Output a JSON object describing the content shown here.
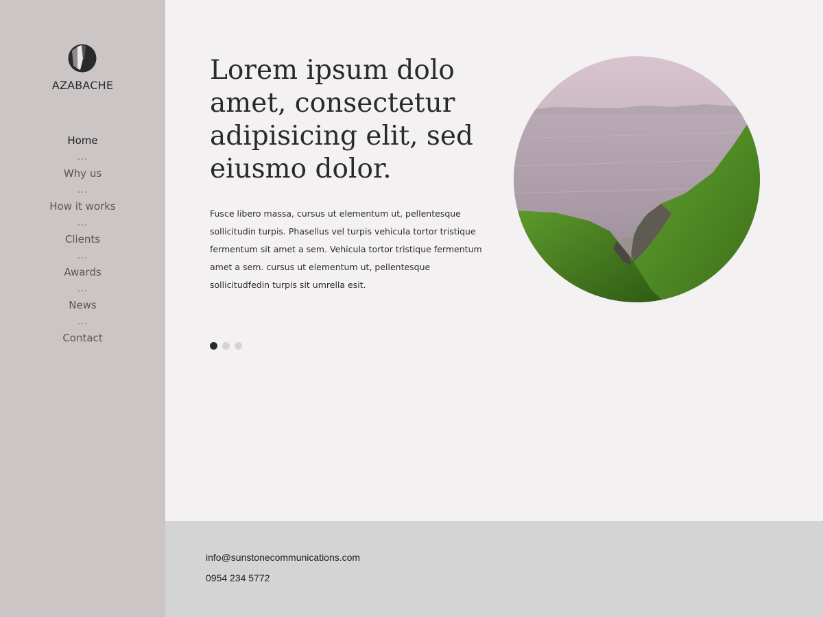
{
  "brand": {
    "name": "AZABACHE",
    "logo_icon": "azabache-logo-icon"
  },
  "nav": {
    "items": [
      {
        "label": "Home",
        "active": true
      },
      {
        "label": "Why us"
      },
      {
        "label": "How it works"
      },
      {
        "label": "Clients"
      },
      {
        "label": "Awards"
      },
      {
        "label": "News"
      },
      {
        "label": "Contact"
      }
    ],
    "separator": "..."
  },
  "hero": {
    "headline": "Lorem ipsum dolo amet, consectetur adipisicing elit, sed eiusmo dolor.",
    "body": "Fusce libero massa, cursus ut elementum ut, pellentesque sollicitudin turpis. Phasellus vel turpis vehicula tortor tristique fermentum sit amet a sem. Vehicula tortor tristique fermentum amet a sem. cursus ut elementum ut, pellentesque sollicitudfedin turpis sit umrella esit.",
    "slider": {
      "total": 3,
      "active_index": 0
    },
    "image_icon": "coastal-landscape-image"
  },
  "footer": {
    "email": "info@sunstonecommunications.com",
    "phone": "0954 234 5772"
  },
  "colors": {
    "sidebar": "#ccc5c5",
    "main": "#f3f1f2",
    "footer": "#d4d4d4",
    "text_dark": "#2b2a2b",
    "dot_active": "#2a2a2a",
    "dot_inactive": "#d6d3d4"
  }
}
